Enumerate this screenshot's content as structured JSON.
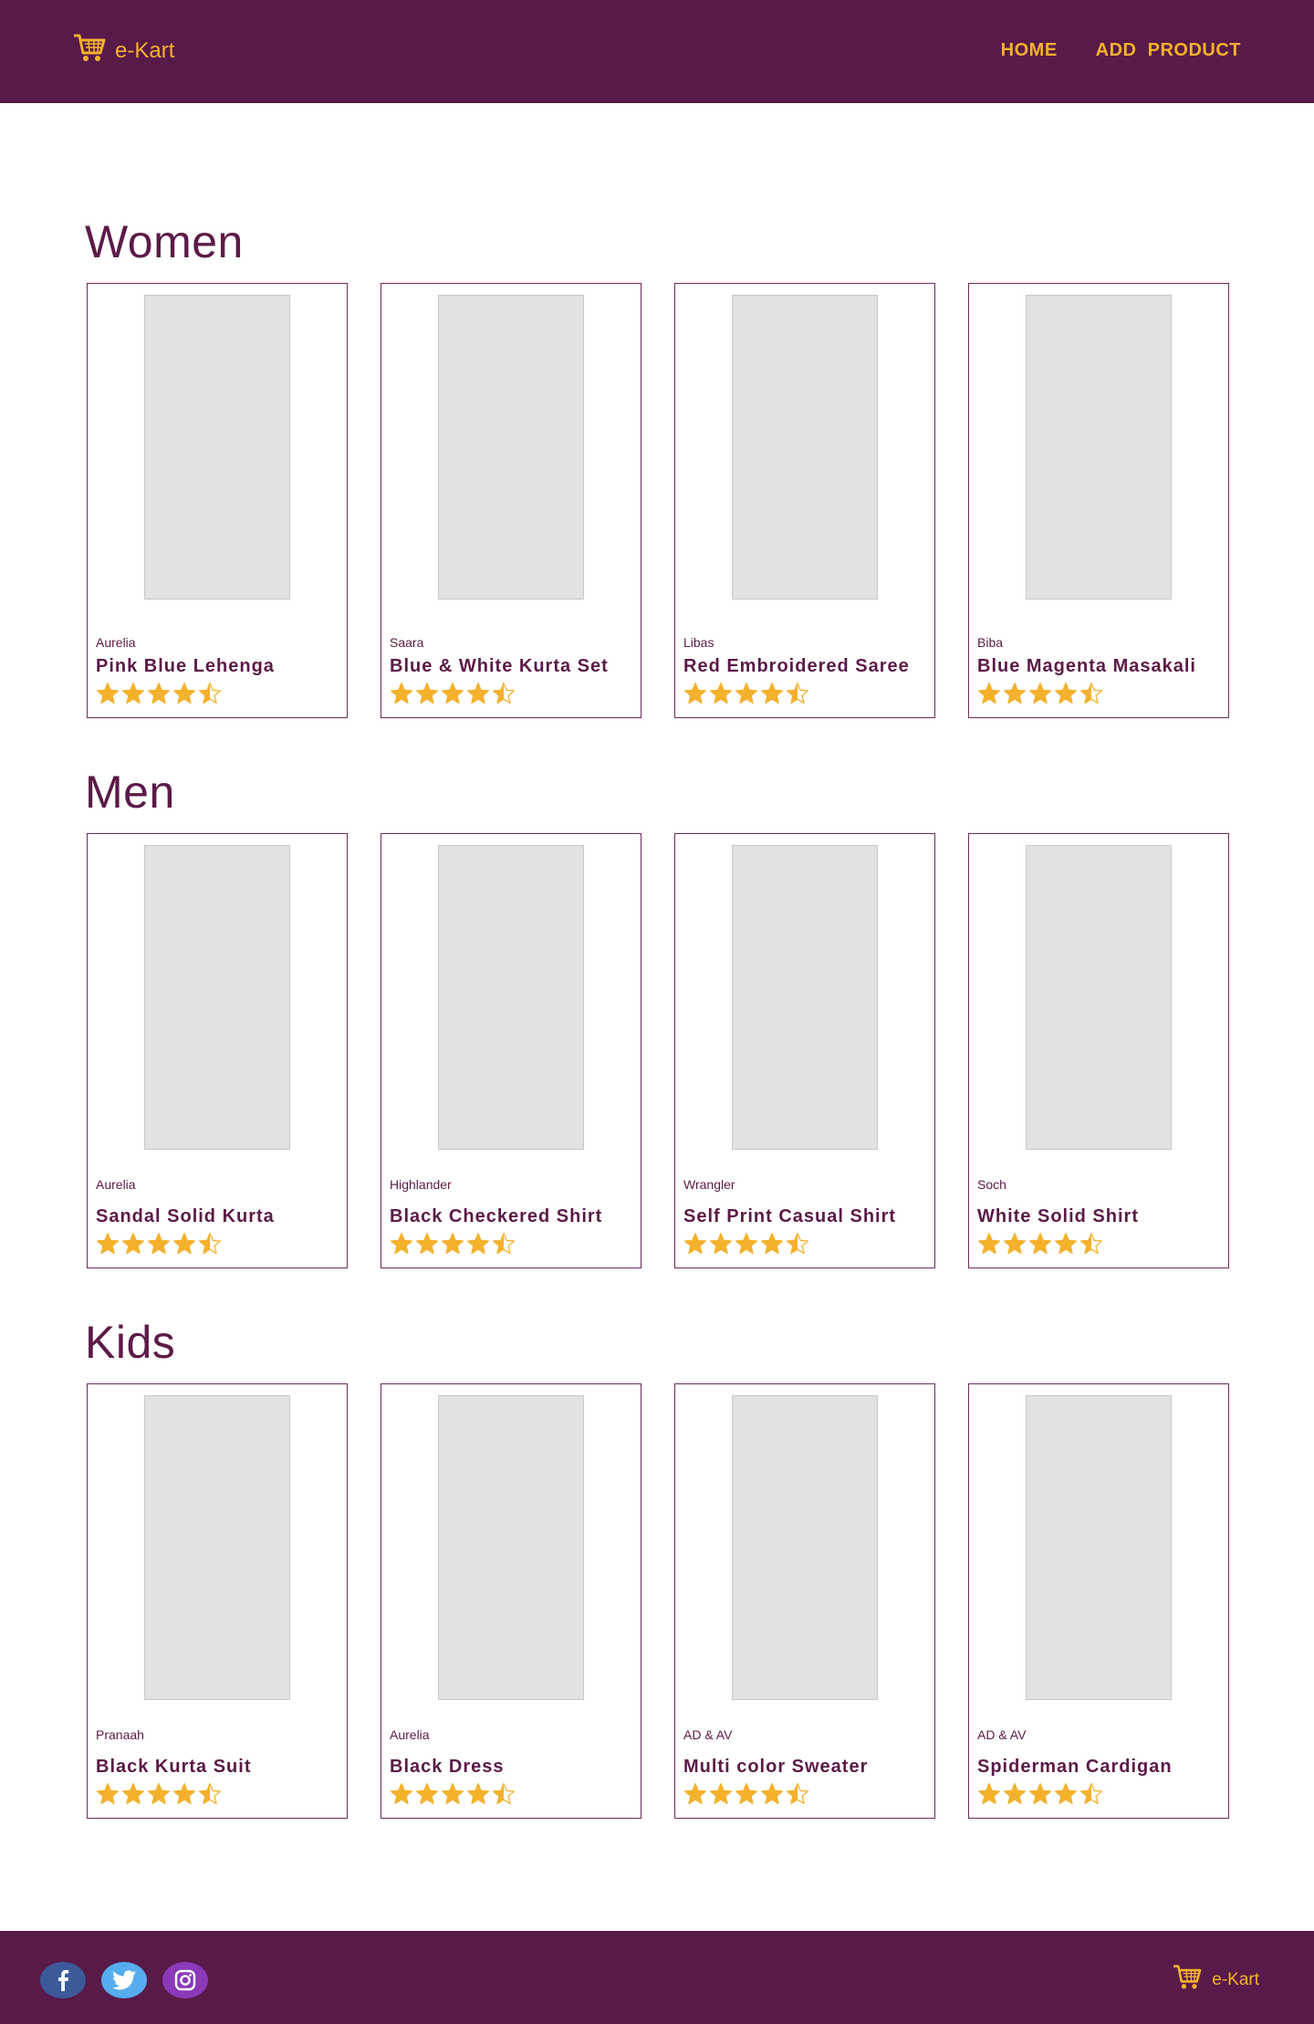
{
  "header": {
    "brand": "e-Kart",
    "nav": {
      "home": "HOME",
      "add_product": "ADD  PRODUCT"
    }
  },
  "colors": {
    "primary": "#581a48",
    "accent": "#f4b12c",
    "text": "#5b1a47"
  },
  "sections": [
    {
      "title": "Women",
      "products": [
        {
          "brand": "Aurelia",
          "name": "Pink Blue Lehenga",
          "rating": 4.5
        },
        {
          "brand": "Saara",
          "name": "Blue & White Kurta Set",
          "rating": 4.5
        },
        {
          "brand": "Libas",
          "name": "Red Embroidered Saree",
          "rating": 4.5
        },
        {
          "brand": "Biba",
          "name": "Blue Magenta Masakali",
          "rating": 4.5
        }
      ]
    },
    {
      "title": "Men",
      "products": [
        {
          "brand": "Aurelia",
          "name": "Sandal Solid Kurta",
          "rating": 4.5
        },
        {
          "brand": "Highlander",
          "name": "Black Checkered Shirt",
          "rating": 4.5
        },
        {
          "brand": "Wrangler",
          "name": "Self Print Casual Shirt",
          "rating": 4.5
        },
        {
          "brand": "Soch",
          "name": "White Solid Shirt",
          "rating": 4.5
        }
      ]
    },
    {
      "title": "Kids",
      "products": [
        {
          "brand": "Pranaah",
          "name": "Black Kurta Suit",
          "rating": 4.5
        },
        {
          "brand": "Aurelia",
          "name": "Black Dress",
          "rating": 4.5
        },
        {
          "brand": "AD & AV",
          "name": "Multi color Sweater",
          "rating": 4.5
        },
        {
          "brand": "AD & AV",
          "name": "Spiderman Cardigan",
          "rating": 4.5
        }
      ]
    }
  ],
  "footer": {
    "brand": "e-Kart",
    "socials": [
      "facebook-icon",
      "twitter-icon",
      "instagram-icon"
    ]
  }
}
